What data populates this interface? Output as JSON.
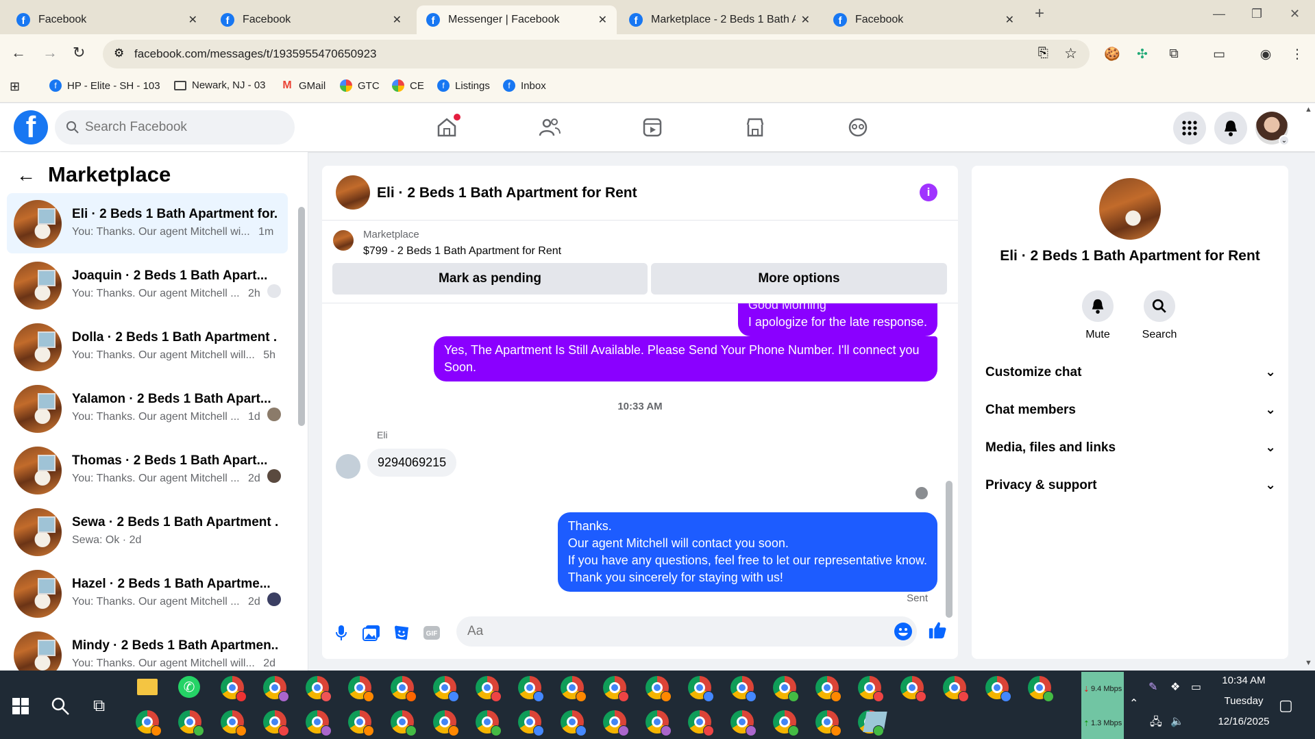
{
  "browser": {
    "tabs": [
      {
        "label": "Facebook"
      },
      {
        "label": "Facebook"
      },
      {
        "label": "Messenger | Facebook"
      },
      {
        "label": "Marketplace - 2 Beds 1 Bath Ap"
      },
      {
        "label": "Facebook"
      }
    ],
    "url": "facebook.com/messages/t/1935955470650923",
    "bookmarks": [
      {
        "label": "HP - Elite - SH - 103",
        "icon": "facebook-icon"
      },
      {
        "label": "Newark, NJ - 03",
        "icon": "folder-icon"
      },
      {
        "label": "GMail",
        "icon": "gmail-icon"
      },
      {
        "label": "GTC",
        "icon": "rainbow-icon"
      },
      {
        "label": "CE",
        "icon": "rainbow-icon"
      },
      {
        "label": "Listings",
        "icon": "facebook-icon"
      },
      {
        "label": "Inbox",
        "icon": "facebook-icon"
      }
    ]
  },
  "fb": {
    "search_placeholder": "Search Facebook",
    "brand_color": "#1877f2"
  },
  "marketplace": {
    "title": "Marketplace",
    "conversations": [
      {
        "title": "Eli · 2 Beds 1 Bath Apartment for...",
        "snippet": "You: Thanks. Our agent Mitchell wi...",
        "time": "1m",
        "active": true
      },
      {
        "title": "Joaquin · 2 Beds 1 Bath Apart...",
        "snippet": "You: Thanks. Our agent Mitchell ...",
        "time": "2h"
      },
      {
        "title": "Dolla · 2 Beds 1 Bath Apartment ...",
        "snippet": "You: Thanks. Our agent Mitchell will...",
        "time": "5h"
      },
      {
        "title": "Yalamon · 2 Beds 1 Bath Apart...",
        "snippet": "You: Thanks. Our agent Mitchell ...",
        "time": "1d"
      },
      {
        "title": "Thomas · 2 Beds 1 Bath Apart...",
        "snippet": "You: Thanks. Our agent Mitchell ...",
        "time": "2d"
      },
      {
        "title": "Sewa · 2 Beds 1 Bath Apartment ...",
        "snippet": "Sewa: Ok",
        "time": "2d"
      },
      {
        "title": "Hazel · 2 Beds 1 Bath Apartme...",
        "snippet": "You: Thanks. Our agent Mitchell ...",
        "time": "2d"
      },
      {
        "title": "Mindy · 2 Beds 1 Bath Apartmen...",
        "snippet": "You: Thanks. Our agent Mitchell will...",
        "time": "2d"
      }
    ]
  },
  "chat": {
    "name": "Eli · 2 Beds 1 Bath Apartment for Rent",
    "listing_source": "Marketplace",
    "listing_title": "$799 - 2 Beds 1 Bath Apartment for Rent",
    "mark_pending": "Mark as pending",
    "more_options": "More options",
    "messages": {
      "m1_line1": "Good Morning",
      "m1_line2": "I apologize for the late response.",
      "m2": "Yes, The Apartment Is Still Available. Please Send Your Phone Number. I'll connect you Soon.",
      "time": "10:33 AM",
      "sender": "Eli",
      "phone": "9294069215",
      "m3_line1": "Thanks.",
      "m3_line2": "Our agent Mitchell will contact you soon.",
      "m3_line3": "If you have any questions, feel free to let our representative know.",
      "m3_line4": "Thank you sincerely for staying with us!",
      "status": "Sent"
    },
    "input_placeholder": "Aa",
    "bubble_purple": "#8a00ff",
    "bubble_blue": "#1d5cff"
  },
  "details": {
    "name": "Eli · 2 Beds 1 Bath Apartment for Rent",
    "mute": "Mute",
    "search": "Search",
    "sections": [
      "Customize chat",
      "Chat members",
      "Media, files and links",
      "Privacy & support"
    ]
  },
  "taskbar": {
    "net_down": "9.4 Mbps",
    "net_up": "1.3 Mbps",
    "time": "10:34 AM",
    "day": "Tuesday",
    "date": "12/16/2025"
  }
}
